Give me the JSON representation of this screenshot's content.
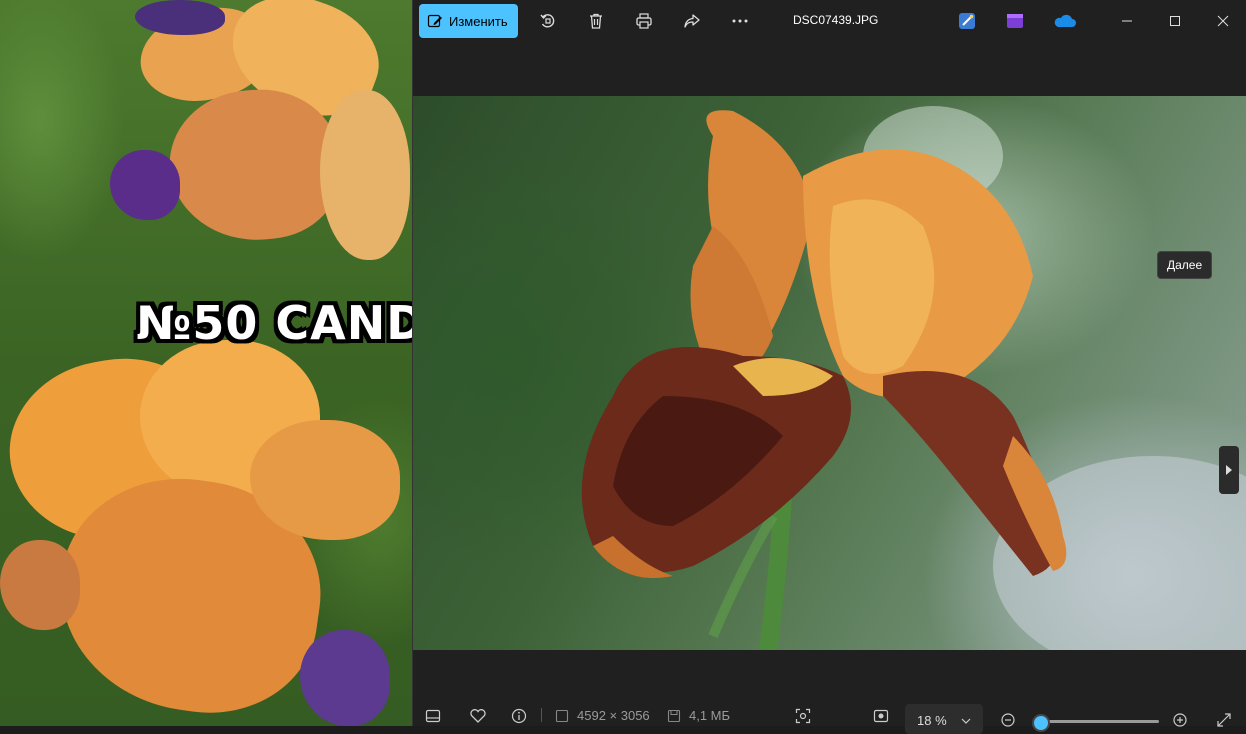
{
  "background_video": {
    "caption": "№50 CAND"
  },
  "toolbar": {
    "edit_label": "Изменить",
    "rotate_icon": "rotate-icon",
    "delete_icon": "trash-icon",
    "print_icon": "print-icon",
    "share_icon": "share-icon",
    "more_icon": "more-icon"
  },
  "title": "DSC07439.JPG",
  "apps": [
    "designer-icon",
    "clipchamp-icon",
    "onedrive-icon"
  ],
  "window_controls": [
    "minimize-icon",
    "maximize-icon",
    "close-icon"
  ],
  "navigation": {
    "next_tooltip": "Далее"
  },
  "statusbar": {
    "dimensions": "4592 × 3056",
    "file_size": "4,1 МБ",
    "zoom": "18 %",
    "zoom_level_fraction": 0.02
  },
  "colors": {
    "accent": "#4cc2ff",
    "background": "#202020"
  }
}
